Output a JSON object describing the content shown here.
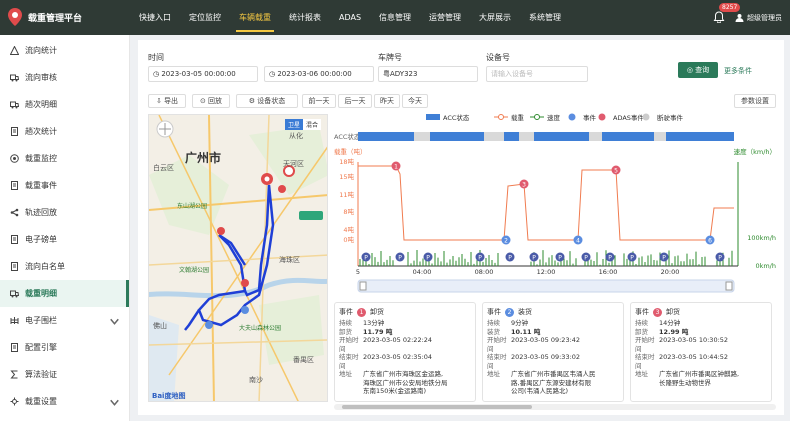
{
  "app": {
    "title": "载重管理平台"
  },
  "nav": [
    "快捷入口",
    "定位监控",
    "车辆载重",
    "统计报表",
    "ADAS",
    "信息管理",
    "运营管理",
    "大屏展示",
    "系统管理"
  ],
  "nav_active_index": 2,
  "header": {
    "badge": "8257",
    "user": "超级管理员"
  },
  "sidebar": [
    {
      "label": "流向统计",
      "icon": "warning-icon"
    },
    {
      "label": "流向审核",
      "icon": "truck-icon"
    },
    {
      "label": "趟次明细",
      "icon": "truck-icon"
    },
    {
      "label": "趟次统计",
      "icon": "document-icon"
    },
    {
      "label": "载重监控",
      "icon": "target-icon"
    },
    {
      "label": "载重事件",
      "icon": "document-icon"
    },
    {
      "label": "轨迹回放",
      "icon": "share-icon"
    },
    {
      "label": "电子磅单",
      "icon": "document-icon"
    },
    {
      "label": "流向白名单",
      "icon": "document-icon"
    },
    {
      "label": "载重明细",
      "icon": "truck-icon"
    },
    {
      "label": "电子围栏",
      "icon": "fence-icon"
    },
    {
      "label": "配置引擎",
      "icon": "document-icon"
    },
    {
      "label": "算法验证",
      "icon": "sigma-icon"
    },
    {
      "label": "载重设置",
      "icon": "gear-icon"
    }
  ],
  "sidebar_active_index": 9,
  "filters": {
    "time_label": "时间",
    "start": "2023-03-05 00:00:00",
    "end": "2023-03-06 00:00:00",
    "plate_label": "车牌号",
    "plate": "粤ADY323",
    "device_label": "设备号",
    "device_placeholder": "请输入设备号",
    "query": "查询",
    "more": "更多条件"
  },
  "toolbar": {
    "export": "导出",
    "playback": "回放",
    "device_status": "设备状态",
    "prev_day": "前一天",
    "next_day": "后一天",
    "yesterday": "昨天",
    "today": "今天",
    "params": "参数设置"
  },
  "map": {
    "city": "广州市",
    "labels": [
      "天河区",
      "白云区",
      "海珠区",
      "番禺区",
      "大夫山森林公园",
      "东山湖公园",
      "文翰湖公园",
      "南沙",
      "佛山",
      "从化"
    ],
    "tab_satellite": "卫星",
    "tab_hybrid": "混合",
    "brand": "Bai度地图"
  },
  "chart_data": {
    "type": "line",
    "legend": [
      "ACC状态",
      "载重",
      "速度",
      "事件",
      "ADAS事件",
      "断驶事件"
    ],
    "acc_label": "ACC状态",
    "ylabel_left": "载重（吨）",
    "ylabel_right": "速度（km/h）",
    "yticks_left": [
      "18吨",
      "15吨",
      "11吨",
      "8吨",
      "4吨",
      "0吨"
    ],
    "yticks_right": [
      "100km/h",
      "0km/h"
    ],
    "xticks": [
      "5",
      "04:00",
      "08:00",
      "12:00",
      "16:00",
      "20:00"
    ],
    "events_markers": [
      "1",
      "2",
      "3",
      "4",
      "5",
      "6"
    ],
    "colors": {
      "acc": "#3f7fd6",
      "load": "#f07b4f",
      "speed": "#2e8b2e",
      "event": "#5b8de0",
      "adas": "#e05b6e"
    }
  },
  "events": [
    {
      "type": "事件",
      "num": "1",
      "name": "卸货",
      "color": "#e05b6e",
      "rows": [
        [
          "持续",
          "13分钟"
        ],
        [
          "卸货",
          "11.79 吨"
        ],
        [
          "开始时间",
          "2023-03-05 02:22:24"
        ],
        [
          "结束时间",
          "2023-03-05 02:35:04"
        ],
        [
          "地址",
          "广东省广州市海珠区金运路,"
        ],
        [
          "",
          "海珠区广州市公安局地铁分局"
        ],
        [
          "",
          "东南150米(金运路南)"
        ]
      ]
    },
    {
      "type": "事件",
      "num": "2",
      "name": "装货",
      "color": "#5b8de0",
      "rows": [
        [
          "持续",
          "9分钟"
        ],
        [
          "装货",
          "10.11 吨"
        ],
        [
          "开始时间",
          "2023-03-05 09:23:42"
        ],
        [
          "结束时间",
          "2023-03-05 09:33:02"
        ],
        [
          "地址",
          "广东省广州市番禺区韦涌人民"
        ],
        [
          "",
          "路,番禺区广东源安建材有限"
        ],
        [
          "",
          "公司(韦涌人民路北)"
        ]
      ]
    },
    {
      "type": "事件",
      "num": "3",
      "name": "卸货",
      "color": "#e05b6e",
      "rows": [
        [
          "持续",
          "14分钟"
        ],
        [
          "卸货",
          "12.99 吨"
        ],
        [
          "开始时间",
          "2023-03-05 10:30:52"
        ],
        [
          "结束时间",
          "2023-03-05 10:44:52"
        ],
        [
          "地址",
          "广东省广州市番禺区钟麒路,"
        ],
        [
          "",
          "长隆野生动物世界"
        ]
      ]
    }
  ]
}
